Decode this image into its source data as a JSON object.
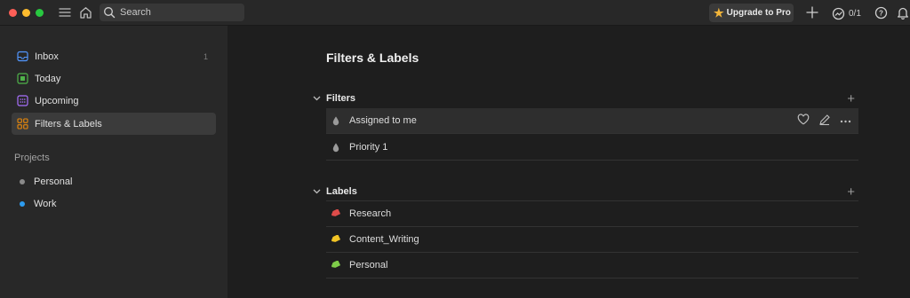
{
  "colors": {
    "accent": "#e44232",
    "star": "#f2b53a",
    "project_personal": "#8a8a8a",
    "project_work": "#2d9cf0",
    "label_research": "#de4c4a",
    "label_content_writing": "#f2c425",
    "label_personal": "#7ecc49"
  },
  "topbar": {
    "search_placeholder": "Search",
    "upgrade_label": "Upgrade to Pro",
    "karma_label": "0/1"
  },
  "sidebar": {
    "items": [
      {
        "label": "Inbox",
        "count": "1",
        "icon": "inbox-icon"
      },
      {
        "label": "Today",
        "icon": "calendar-today-icon"
      },
      {
        "label": "Upcoming",
        "icon": "calendar-upcoming-icon"
      },
      {
        "label": "Filters & Labels",
        "icon": "filters-labels-icon"
      }
    ],
    "projects_title": "Projects",
    "projects": [
      {
        "label": "Personal"
      },
      {
        "label": "Work"
      }
    ]
  },
  "main": {
    "title": "Filters & Labels",
    "filters": {
      "title": "Filters",
      "items": [
        {
          "label": "Assigned to me"
        },
        {
          "label": "Priority 1"
        }
      ]
    },
    "labels": {
      "title": "Labels",
      "items": [
        {
          "label": "Research"
        },
        {
          "label": "Content_Writing"
        },
        {
          "label": "Personal"
        }
      ]
    }
  }
}
